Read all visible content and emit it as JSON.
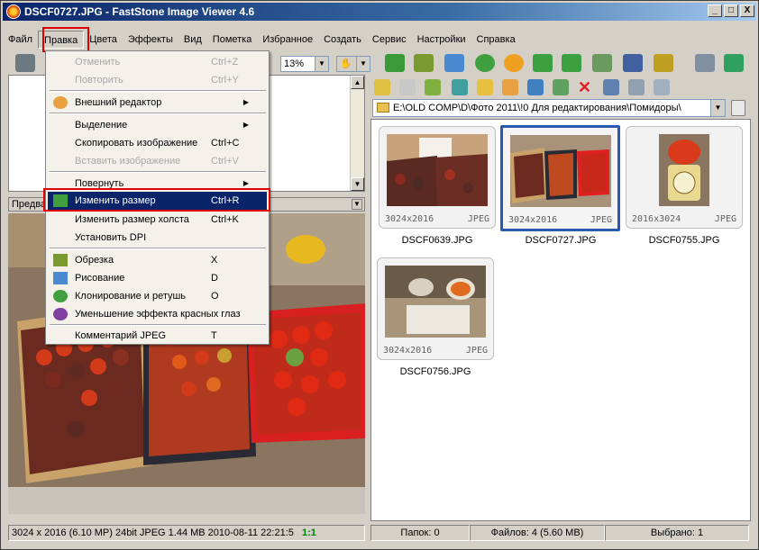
{
  "window": {
    "title": "DSCF0727.JPG - FastStone Image Viewer 4.6",
    "controls": [
      "_",
      "□",
      "X"
    ]
  },
  "menubar": [
    "Файл",
    "Правка",
    "Цвета",
    "Эффекты",
    "Вид",
    "Пометка",
    "Избранное",
    "Создать",
    "Сервис",
    "Настройки",
    "Справка"
  ],
  "toolbar": {
    "zoom_value": "13%",
    "icons": [
      "camera-icon",
      "import-icon",
      "crop-icon",
      "draw-icon",
      "clone-icon",
      "sun-icon",
      "rotate-left-icon",
      "rotate-right-icon",
      "compare-icon",
      "slideshow-icon",
      "screen-icon",
      "list-view-icon",
      "fullscreen-icon"
    ]
  },
  "edit_menu": {
    "items": [
      {
        "label": "Отменить",
        "shortcut": "Ctrl+Z",
        "disabled": true
      },
      {
        "label": "Повторить",
        "shortcut": "Ctrl+Y",
        "disabled": true
      },
      {
        "label": "Внешний редактор",
        "submenu": true,
        "icon": "palette-icon"
      },
      {
        "label": "Выделение",
        "submenu": true
      },
      {
        "label": "Скопировать изображение",
        "shortcut": "Ctrl+C"
      },
      {
        "label": "Вставить изображение",
        "shortcut": "Ctrl+V",
        "disabled": true
      },
      {
        "label": "Повернуть",
        "submenu": true
      },
      {
        "label": "Изменить размер",
        "shortcut": "Ctrl+R",
        "highlighted": true,
        "icon": "resize-icon"
      },
      {
        "label": "Изменить размер холста",
        "shortcut": "Ctrl+K"
      },
      {
        "label": "Установить DPI"
      },
      {
        "label": "Обрезка",
        "shortcut": "X",
        "icon": "crop-icon"
      },
      {
        "label": "Рисование",
        "shortcut": "D",
        "icon": "draw-icon"
      },
      {
        "label": "Клонирование и ретушь",
        "shortcut": "O",
        "icon": "clone-icon"
      },
      {
        "label": "Уменьшение эффекта красных глаз",
        "icon": "red-eye-icon"
      },
      {
        "label": "Комментарий JPEG",
        "shortcut": "T"
      }
    ]
  },
  "preview_header": "Предва",
  "path": "E:\\OLD COMP\\D\\Фото 2011\\!0 Для редактирования\\Помидоры\\",
  "thumbnails": [
    {
      "name": "DSCF0639.JPG",
      "dims": "3024x2016",
      "format": "JPEG"
    },
    {
      "name": "DSCF0727.JPG",
      "dims": "3024x2016",
      "format": "JPEG",
      "selected": true
    },
    {
      "name": "DSCF0755.JPG",
      "dims": "2016x3024",
      "format": "JPEG"
    },
    {
      "name": "DSCF0756.JPG",
      "dims": "3024x2016",
      "format": "JPEG"
    }
  ],
  "status_left": {
    "info": "3024 x 2016 (6.10 MP)  24bit  JPEG  1.44 MB  2010-08-11 22:21:5",
    "ratio": "1:1"
  },
  "status_right": {
    "folders": "Папок: 0",
    "files": "Файлов: 4 (5.60 MB)",
    "selected": "Выбрано: 1"
  }
}
